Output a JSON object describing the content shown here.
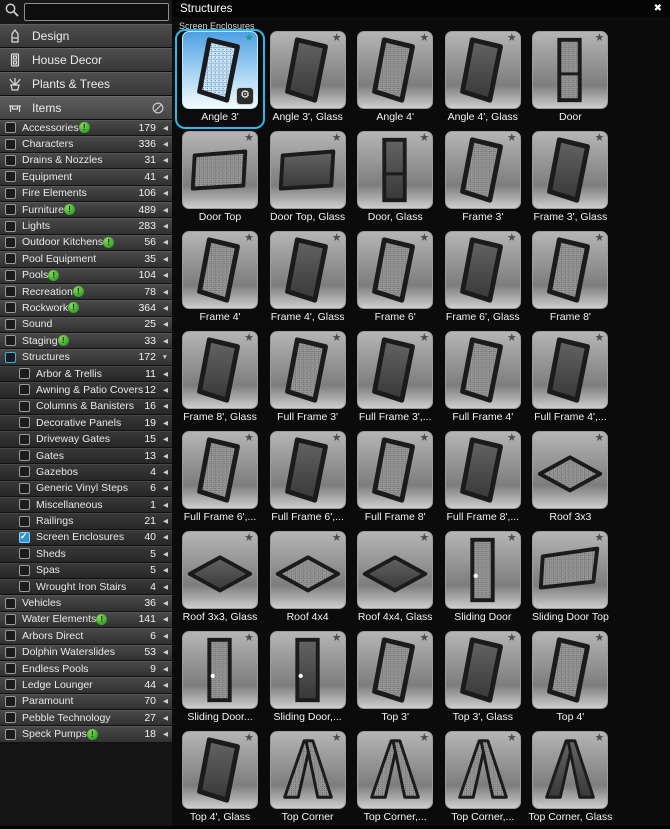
{
  "window": {
    "panel_title": "Structures",
    "close_label": "✖",
    "section_label": "Screen Enclosures"
  },
  "colors": {
    "accent_cyan": "#2ab9ec",
    "selection_sky_top": "#4f9fe2",
    "check_blue": "#2f93d6",
    "badge_green": "#38a32b",
    "star_teal": "#1f9e8e",
    "row_dark": "#313131"
  },
  "sidebar": {
    "search": {
      "placeholder": "",
      "value": "",
      "icon": "search-icon"
    },
    "menu": [
      {
        "label": "Design",
        "icon": "pencil-icon",
        "active": false
      },
      {
        "label": "House Decor",
        "icon": "door-icon",
        "active": false
      },
      {
        "label": "Plants & Trees",
        "icon": "plant-icon",
        "active": false
      },
      {
        "label": "Items",
        "icon": "table-icon",
        "active": true,
        "right_icon": "prohibition-icon"
      }
    ],
    "categories": [
      {
        "label": "Accessories",
        "count": "179",
        "badge": true,
        "indent": false,
        "check": "none",
        "arrow": "left"
      },
      {
        "label": "Characters",
        "count": "336",
        "badge": false,
        "indent": false,
        "check": "none",
        "arrow": "left"
      },
      {
        "label": "Drains & Nozzles",
        "count": "31",
        "badge": false,
        "indent": false,
        "check": "none",
        "arrow": "left"
      },
      {
        "label": "Equipment",
        "count": "41",
        "badge": false,
        "indent": false,
        "check": "none",
        "arrow": "left"
      },
      {
        "label": "Fire Elements",
        "count": "106",
        "badge": false,
        "indent": false,
        "check": "none",
        "arrow": "left"
      },
      {
        "label": "Furniture",
        "count": "489",
        "badge": true,
        "indent": false,
        "check": "none",
        "arrow": "left"
      },
      {
        "label": "Lights",
        "count": "283",
        "badge": false,
        "indent": false,
        "check": "none",
        "arrow": "left"
      },
      {
        "label": "Outdoor Kitchens",
        "count": "56",
        "badge": true,
        "indent": false,
        "check": "none",
        "arrow": "left"
      },
      {
        "label": "Pool Equipment",
        "count": "35",
        "badge": false,
        "indent": false,
        "check": "none",
        "arrow": "left"
      },
      {
        "label": "Pools",
        "count": "104",
        "badge": true,
        "indent": false,
        "check": "none",
        "arrow": "left"
      },
      {
        "label": "Recreation",
        "count": "78",
        "badge": true,
        "indent": false,
        "check": "none",
        "arrow": "left"
      },
      {
        "label": "Rockwork",
        "count": "364",
        "badge": true,
        "indent": false,
        "check": "none",
        "arrow": "left"
      },
      {
        "label": "Sound",
        "count": "25",
        "badge": false,
        "indent": false,
        "check": "none",
        "arrow": "left"
      },
      {
        "label": "Staging",
        "count": "33",
        "badge": true,
        "indent": false,
        "check": "none",
        "arrow": "left"
      },
      {
        "label": "Structures",
        "count": "172",
        "badge": false,
        "indent": false,
        "check": "partial",
        "arrow": "down"
      },
      {
        "label": "Arbor & Trellis",
        "count": "11",
        "badge": false,
        "indent": true,
        "check": "none",
        "arrow": "left"
      },
      {
        "label": "Awning & Patio Covers",
        "count": "12",
        "badge": false,
        "indent": true,
        "check": "none",
        "arrow": "left"
      },
      {
        "label": "Columns & Banisters",
        "count": "16",
        "badge": false,
        "indent": true,
        "check": "none",
        "arrow": "left"
      },
      {
        "label": "Decorative Panels",
        "count": "19",
        "badge": false,
        "indent": true,
        "check": "none",
        "arrow": "left"
      },
      {
        "label": "Driveway Gates",
        "count": "15",
        "badge": false,
        "indent": true,
        "check": "none",
        "arrow": "left"
      },
      {
        "label": "Gates",
        "count": "13",
        "badge": false,
        "indent": true,
        "check": "none",
        "arrow": "left"
      },
      {
        "label": "Gazebos",
        "count": "4",
        "badge": false,
        "indent": true,
        "check": "none",
        "arrow": "left"
      },
      {
        "label": "Generic Vinyl Steps",
        "count": "6",
        "badge": false,
        "indent": true,
        "check": "none",
        "arrow": "left"
      },
      {
        "label": "Miscellaneous",
        "count": "1",
        "badge": false,
        "indent": true,
        "check": "none",
        "arrow": "left"
      },
      {
        "label": "Railings",
        "count": "21",
        "badge": false,
        "indent": true,
        "check": "none",
        "arrow": "left"
      },
      {
        "label": "Screen Enclosures",
        "count": "40",
        "badge": false,
        "indent": true,
        "check": "checked",
        "arrow": "left"
      },
      {
        "label": "Sheds",
        "count": "5",
        "badge": false,
        "indent": true,
        "check": "none",
        "arrow": "left"
      },
      {
        "label": "Spas",
        "count": "5",
        "badge": false,
        "indent": true,
        "check": "none",
        "arrow": "left"
      },
      {
        "label": "Wrought Iron Stairs",
        "count": "4",
        "badge": false,
        "indent": true,
        "check": "none",
        "arrow": "left"
      },
      {
        "label": "Vehicles",
        "count": "36",
        "badge": false,
        "indent": false,
        "check": "none",
        "arrow": "left"
      },
      {
        "label": "Water Elements",
        "count": "141",
        "badge": true,
        "indent": false,
        "check": "none",
        "arrow": "left"
      },
      {
        "label": "Arbors Direct",
        "count": "6",
        "badge": false,
        "indent": false,
        "check": "none",
        "arrow": "left"
      },
      {
        "label": "Dolphin Waterslides",
        "count": "53",
        "badge": false,
        "indent": false,
        "check": "none",
        "arrow": "left"
      },
      {
        "label": "Endless Pools",
        "count": "9",
        "badge": false,
        "indent": false,
        "check": "none",
        "arrow": "left"
      },
      {
        "label": "Ledge Lounger",
        "count": "44",
        "badge": false,
        "indent": false,
        "check": "none",
        "arrow": "left"
      },
      {
        "label": "Paramount",
        "count": "70",
        "badge": false,
        "indent": false,
        "check": "none",
        "arrow": "left"
      },
      {
        "label": "Pebble Technology",
        "count": "27",
        "badge": false,
        "indent": false,
        "check": "none",
        "arrow": "left"
      },
      {
        "label": "Speck Pumps",
        "count": "18",
        "badge": true,
        "indent": false,
        "check": "none",
        "arrow": "left"
      }
    ]
  },
  "grid": {
    "columns": 5,
    "items": [
      {
        "label": "Angle 3'",
        "shape": "panel-mesh",
        "selected": true,
        "star": true
      },
      {
        "label": "Angle 3', Glass",
        "shape": "panel-glass",
        "selected": false,
        "star": true
      },
      {
        "label": "Angle 4'",
        "shape": "panel-mesh",
        "selected": false,
        "star": true
      },
      {
        "label": "Angle 4', Glass",
        "shape": "panel-glass",
        "selected": false,
        "star": true
      },
      {
        "label": "Door",
        "shape": "door-mesh",
        "selected": false,
        "star": true
      },
      {
        "label": "Door Top",
        "shape": "doortop-mesh",
        "selected": false,
        "star": true
      },
      {
        "label": "Door Top, Glass",
        "shape": "doortop-glass",
        "selected": false,
        "star": true
      },
      {
        "label": "Door, Glass",
        "shape": "door-glass",
        "selected": false,
        "star": true
      },
      {
        "label": "Frame 3'",
        "shape": "panel-mesh",
        "selected": false,
        "star": true
      },
      {
        "label": "Frame 3', Glass",
        "shape": "panel-glass",
        "selected": false,
        "star": true
      },
      {
        "label": "Frame 4'",
        "shape": "panel-mesh",
        "selected": false,
        "star": true
      },
      {
        "label": "Frame 4', Glass",
        "shape": "panel-glass",
        "selected": false,
        "star": true
      },
      {
        "label": "Frame 6'",
        "shape": "panel-mesh",
        "selected": false,
        "star": true
      },
      {
        "label": "Frame 6', Glass",
        "shape": "panel-glass",
        "selected": false,
        "star": true
      },
      {
        "label": "Frame 8'",
        "shape": "panel-mesh",
        "selected": false,
        "star": true
      },
      {
        "label": "Frame 8', Glass",
        "shape": "panel-glass",
        "selected": false,
        "star": true
      },
      {
        "label": "Full Frame 3'",
        "shape": "panel-mesh",
        "selected": false,
        "star": true
      },
      {
        "label": "Full Frame 3',...",
        "shape": "panel-glass",
        "selected": false,
        "star": true
      },
      {
        "label": "Full Frame 4'",
        "shape": "panel-mesh",
        "selected": false,
        "star": true
      },
      {
        "label": "Full Frame 4',...",
        "shape": "panel-glass",
        "selected": false,
        "star": true
      },
      {
        "label": "Full Frame 6',...",
        "shape": "panel-mesh",
        "selected": false,
        "star": true
      },
      {
        "label": "Full Frame 6',...",
        "shape": "panel-glass",
        "selected": false,
        "star": true
      },
      {
        "label": "Full Frame 8'",
        "shape": "panel-mesh",
        "selected": false,
        "star": true
      },
      {
        "label": "Full Frame 8',...",
        "shape": "panel-glass",
        "selected": false,
        "star": true
      },
      {
        "label": "Roof 3x3",
        "shape": "roof-mesh",
        "selected": false,
        "star": true
      },
      {
        "label": "Roof 3x3, Glass",
        "shape": "roof-glass",
        "selected": false,
        "star": true
      },
      {
        "label": "Roof 4x4",
        "shape": "roof-mesh",
        "selected": false,
        "star": true
      },
      {
        "label": "Roof 4x4, Glass",
        "shape": "roof-glass",
        "selected": false,
        "star": true
      },
      {
        "label": "Sliding Door",
        "shape": "slidedoor-mesh",
        "selected": false,
        "star": true
      },
      {
        "label": "Sliding Door Top",
        "shape": "slidetop-mesh",
        "selected": false,
        "star": true
      },
      {
        "label": "Sliding Door...",
        "shape": "slidedoor-mesh",
        "selected": false,
        "star": true
      },
      {
        "label": "Sliding Door,...",
        "shape": "slidedoor-glass",
        "selected": false,
        "star": true
      },
      {
        "label": "Top 3'",
        "shape": "panel-mesh",
        "selected": false,
        "star": true
      },
      {
        "label": "Top 3', Glass",
        "shape": "panel-glass",
        "selected": false,
        "star": true
      },
      {
        "label": "Top 4'",
        "shape": "panel-mesh",
        "selected": false,
        "star": true
      },
      {
        "label": "Top 4', Glass",
        "shape": "panel-glass",
        "selected": false,
        "star": true
      },
      {
        "label": "Top Corner",
        "shape": "corner-mesh",
        "selected": false,
        "star": true
      },
      {
        "label": "Top Corner,...",
        "shape": "corner-mesh",
        "selected": false,
        "star": true
      },
      {
        "label": "Top Corner,...",
        "shape": "corner-mesh",
        "selected": false,
        "star": true
      },
      {
        "label": "Top Corner, Glass",
        "shape": "corner-glass",
        "selected": false,
        "star": true
      }
    ]
  }
}
